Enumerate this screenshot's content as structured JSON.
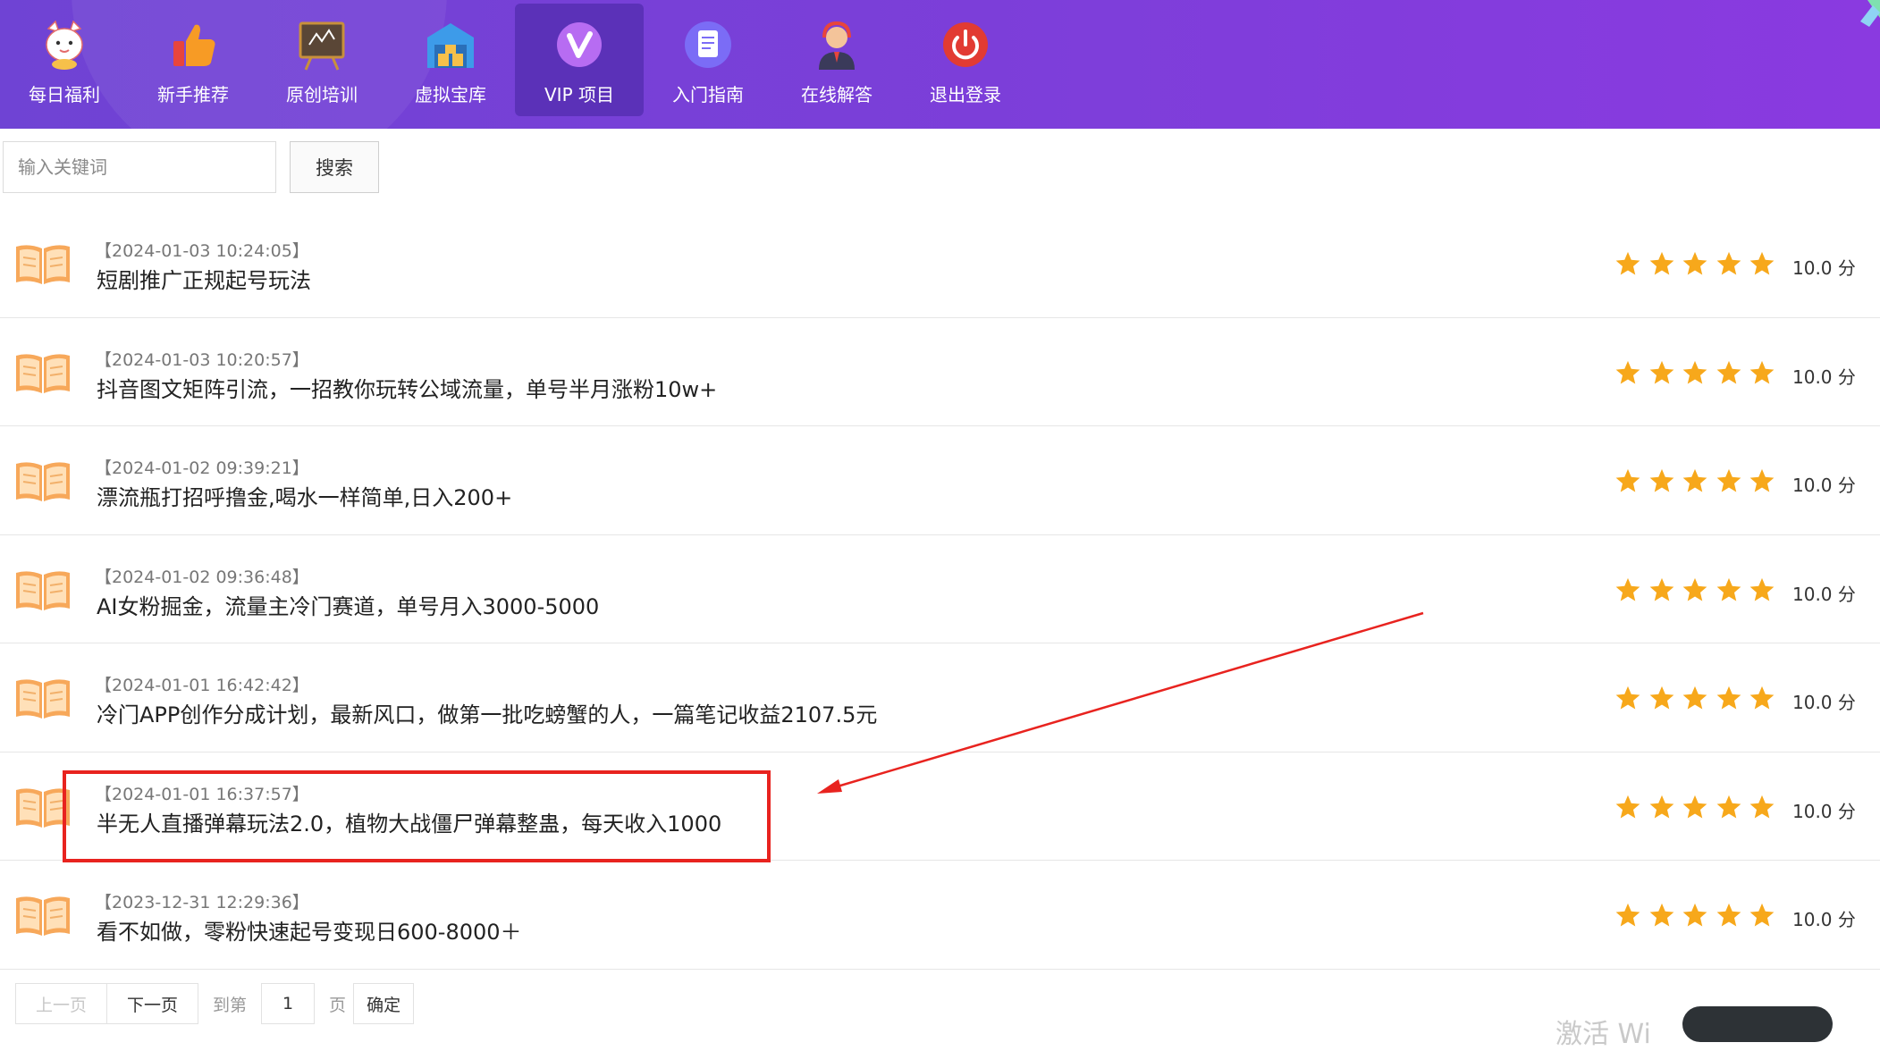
{
  "nav": {
    "items": [
      {
        "label": "每日福利",
        "icon": "lucky-cat-icon",
        "active": false
      },
      {
        "label": "新手推荐",
        "icon": "thumbs-up-icon",
        "active": false
      },
      {
        "label": "原创培训",
        "icon": "chalkboard-icon",
        "active": false
      },
      {
        "label": "虚拟宝库",
        "icon": "warehouse-icon",
        "active": false
      },
      {
        "label": "VIP 项目",
        "icon": "vip-icon",
        "active": true
      },
      {
        "label": "入门指南",
        "icon": "document-icon",
        "active": false
      },
      {
        "label": "在线解答",
        "icon": "support-agent-icon",
        "active": false
      },
      {
        "label": "退出登录",
        "icon": "power-icon",
        "active": false
      }
    ]
  },
  "search": {
    "placeholder": "输入关键词",
    "button_label": "搜索"
  },
  "list": {
    "rows": [
      {
        "date": "【2024-01-03 10:24:05】",
        "title": "短剧推广正规起号玩法",
        "rating": 5,
        "score": "10.0 分"
      },
      {
        "date": "【2024-01-03 10:20:57】",
        "title": "抖音图文矩阵引流，一招教你玩转公域流量，单号半月涨粉10w+",
        "rating": 5,
        "score": "10.0 分"
      },
      {
        "date": "【2024-01-02 09:39:21】",
        "title": "漂流瓶打招呼撸金,喝水一样简单,日入200+",
        "rating": 5,
        "score": "10.0 分"
      },
      {
        "date": "【2024-01-02 09:36:48】",
        "title": "AI女粉掘金，流量主冷门赛道，单号月入3000-5000",
        "rating": 5,
        "score": "10.0 分"
      },
      {
        "date": "【2024-01-01 16:42:42】",
        "title": "冷门APP创作分成计划，最新风口，做第一批吃螃蟹的人，一篇笔记收益2107.5元",
        "rating": 5,
        "score": "10.0 分"
      },
      {
        "date": "【2024-01-01 16:37:57】",
        "title": "半无人直播弹幕玩法2.0，植物大战僵尸弹幕整蛊，每天收入1000",
        "rating": 5,
        "score": "10.0 分"
      },
      {
        "date": "【2023-12-31 12:29:36】",
        "title": "看不如做，零粉快速起号变现日600-8000＋",
        "rating": 5,
        "score": "10.0 分"
      }
    ]
  },
  "pager": {
    "prev_label": "上一页",
    "next_label": "下一页",
    "goto_label": "到第",
    "page_value": "1",
    "page_unit": "页",
    "confirm_label": "确定"
  },
  "watermark": "激活 Wi",
  "colors": {
    "header_start": "#6f43d4",
    "header_end": "#8a3ae0",
    "star": "#f7a81b",
    "annotation": "#e8231f"
  }
}
